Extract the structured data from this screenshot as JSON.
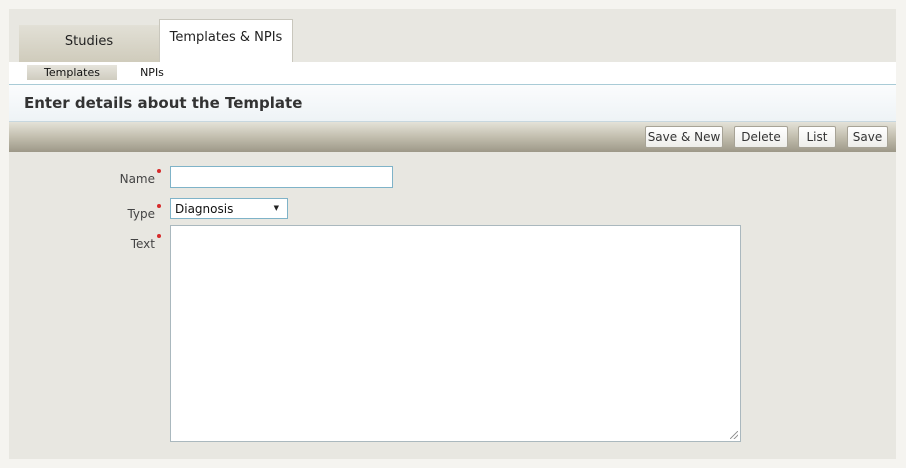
{
  "tabs": [
    {
      "label": "Studies",
      "active": false
    },
    {
      "label": "Templates & NPIs",
      "active": true
    }
  ],
  "subnav": [
    {
      "label": "Templates",
      "active": true
    },
    {
      "label": "NPIs",
      "active": false
    }
  ],
  "section": {
    "title": "Enter details about the Template"
  },
  "toolbar": {
    "save_new_label": "Save & New",
    "delete_label": "Delete",
    "list_label": "List",
    "save_label": "Save"
  },
  "form": {
    "name": {
      "label": "Name",
      "value": "",
      "required": true
    },
    "type": {
      "label": "Type",
      "value": "Diagnosis",
      "required": true
    },
    "text": {
      "label": "Text",
      "value": "",
      "required": true
    }
  },
  "colors": {
    "required_marker": "#d62b2b",
    "input_border": "#7fb3c8",
    "toolbar_bottom": "#9d9888"
  }
}
